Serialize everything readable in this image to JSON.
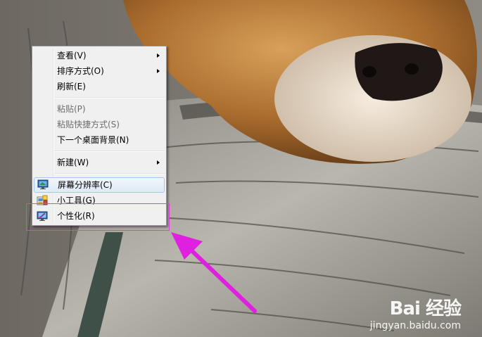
{
  "context_menu": {
    "items": [
      {
        "label": "查看(V)",
        "submenu": true
      },
      {
        "label": "排序方式(O)",
        "submenu": true
      },
      {
        "label": "刷新(E)"
      },
      {
        "label": "粘贴(P)",
        "disabled": true
      },
      {
        "label": "粘贴快捷方式(S)",
        "disabled": true
      },
      {
        "label": "下一个桌面背景(N)"
      },
      {
        "label": "新建(W)",
        "submenu": true
      },
      {
        "label": "屏幕分辨率(C)",
        "icon": "display-resolution-icon",
        "highlighted": true
      },
      {
        "label": "小工具(G)",
        "icon": "gadgets-icon"
      },
      {
        "label": "个性化(R)",
        "icon": "personalize-icon"
      }
    ]
  },
  "annotation": {
    "box_color": "#e63ce6",
    "arrow_color": "#e020e0"
  },
  "watermark": {
    "logo_text": "Bai 经验",
    "url": "jingyan.baidu.com"
  }
}
